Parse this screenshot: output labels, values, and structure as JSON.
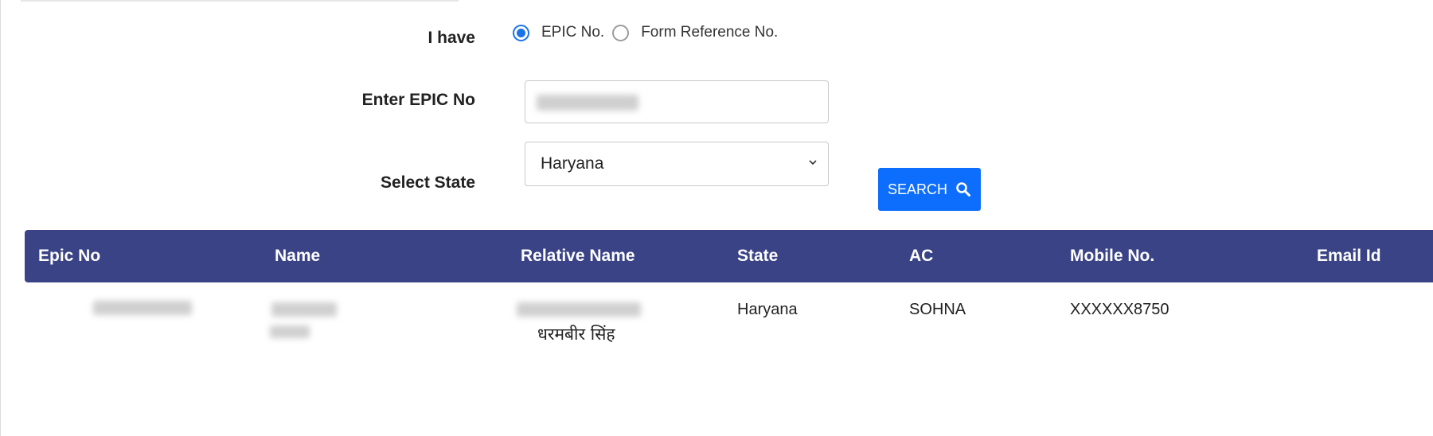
{
  "form": {
    "i_have_label": "I have",
    "radio_options": [
      {
        "label": "EPIC No.",
        "checked": true
      },
      {
        "label": "Form Reference No.",
        "checked": false
      }
    ],
    "epic_label": "Enter EPIC No",
    "epic_value_redacted": true,
    "state_label": "Select State",
    "state_value": "Haryana",
    "search_button": "SEARCH"
  },
  "table": {
    "headers": [
      "Epic No",
      "Name",
      "Relative Name",
      "State",
      "AC",
      "Mobile No.",
      "Email Id"
    ],
    "rows": [
      {
        "epic_no_redacted": true,
        "name_redacted": true,
        "relative_name_hindi": "धरमबीर सिंह",
        "state": "Haryana",
        "ac": "SOHNA",
        "mobile": "XXXXXX8750",
        "email": ""
      }
    ]
  },
  "colors": {
    "header_bg": "#3a4386",
    "button_bg": "#0d6efd",
    "radio_accent": "#1a73e8"
  }
}
